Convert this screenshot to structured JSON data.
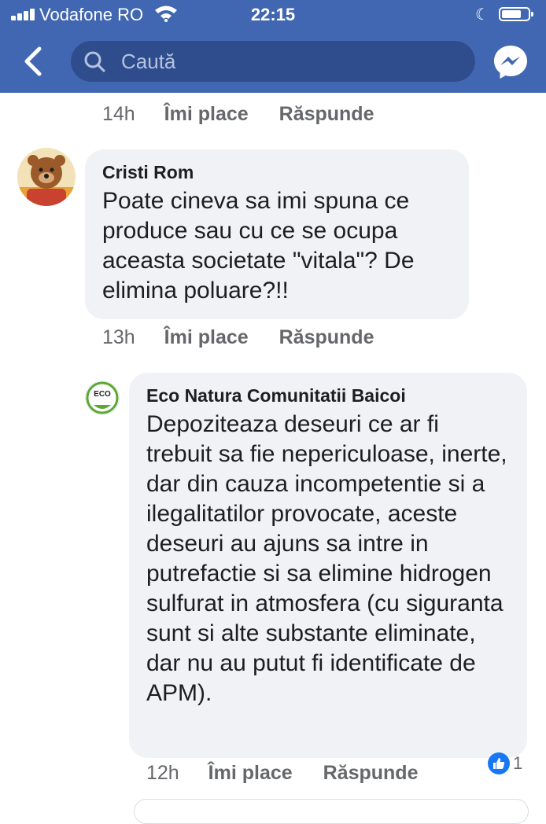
{
  "status_bar": {
    "carrier": "Vodafone RO",
    "time": "22:15"
  },
  "header": {
    "search_placeholder": "Caută"
  },
  "comments": [
    {
      "time": "14h",
      "like_label": "Îmi place",
      "reply_label": "Răspunde"
    },
    {
      "author": "Cristi Rom",
      "text": "Poate cineva sa imi spuna ce produce sau cu ce se ocupa aceasta societate \"vitala\"? De elimina poluare?!!",
      "time": "13h",
      "like_label": "Îmi place",
      "reply_label": "Răspunde"
    },
    {
      "author": "Eco Natura Comunitatii Baicoi",
      "text": "Depoziteaza deseuri ce ar fi trebuit sa fie nepericuloase, inerte, dar din cauza incompetentie si a ilegalitatilor provocate, aceste deseuri au ajuns sa intre in putrefactie si sa elimine hidrogen sulfurat in atmosfera (cu siguranta sunt si alte substante eliminate, dar nu au putut fi identificate de APM).",
      "time": "12h",
      "like_label": "Îmi place",
      "reply_label": "Răspunde",
      "reaction_count": "1",
      "avatar_logo_text": "ECO"
    }
  ],
  "colors": {
    "header_bg": "#4267b2",
    "search_bg": "#2f4d8c",
    "bubble_bg": "#f0f2f5",
    "meta_text": "#65676b",
    "like_blue": "#1877f2"
  }
}
